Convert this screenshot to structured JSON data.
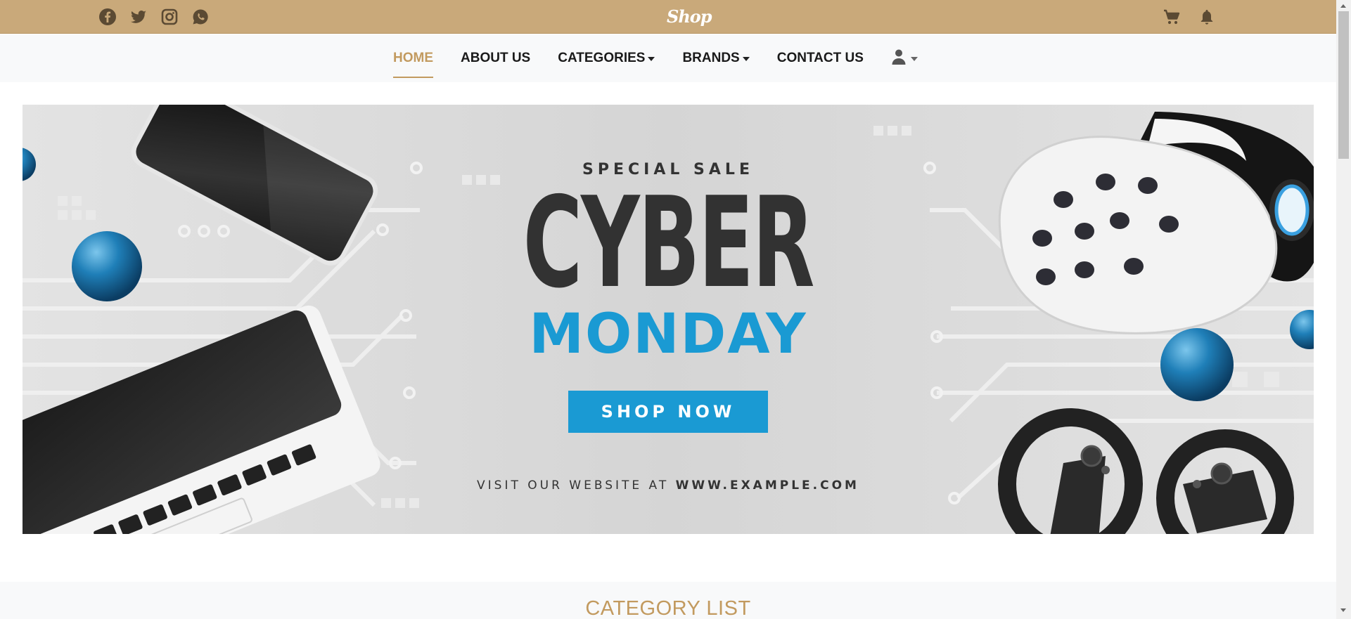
{
  "topbar": {
    "logo": "Shop",
    "social_icons": [
      "facebook-icon",
      "twitter-icon",
      "instagram-icon",
      "whatsapp-icon"
    ],
    "right_icons": [
      "cart-icon",
      "bell-icon"
    ],
    "background": "#c9a97a"
  },
  "nav": {
    "items": [
      {
        "label": "HOME",
        "active": true,
        "dropdown": false
      },
      {
        "label": "ABOUT US",
        "active": false,
        "dropdown": false
      },
      {
        "label": "CATEGORIES",
        "active": false,
        "dropdown": true
      },
      {
        "label": "BRANDS",
        "active": false,
        "dropdown": true
      },
      {
        "label": "CONTACT US",
        "active": false,
        "dropdown": false
      }
    ],
    "user_icon": "user-icon",
    "accent": "#c29a5f"
  },
  "banner": {
    "kicker": "SPECIAL SALE",
    "headline_1": "CYBER",
    "headline_2": "MONDAY",
    "cta": "SHOP NOW",
    "visit_prefix": "VISIT OUR WEBSITE AT",
    "visit_url": "WWW.EXAMPLE.COM",
    "accent": "#1a9ad3"
  },
  "category": {
    "title": "CATEGORY LIST"
  }
}
